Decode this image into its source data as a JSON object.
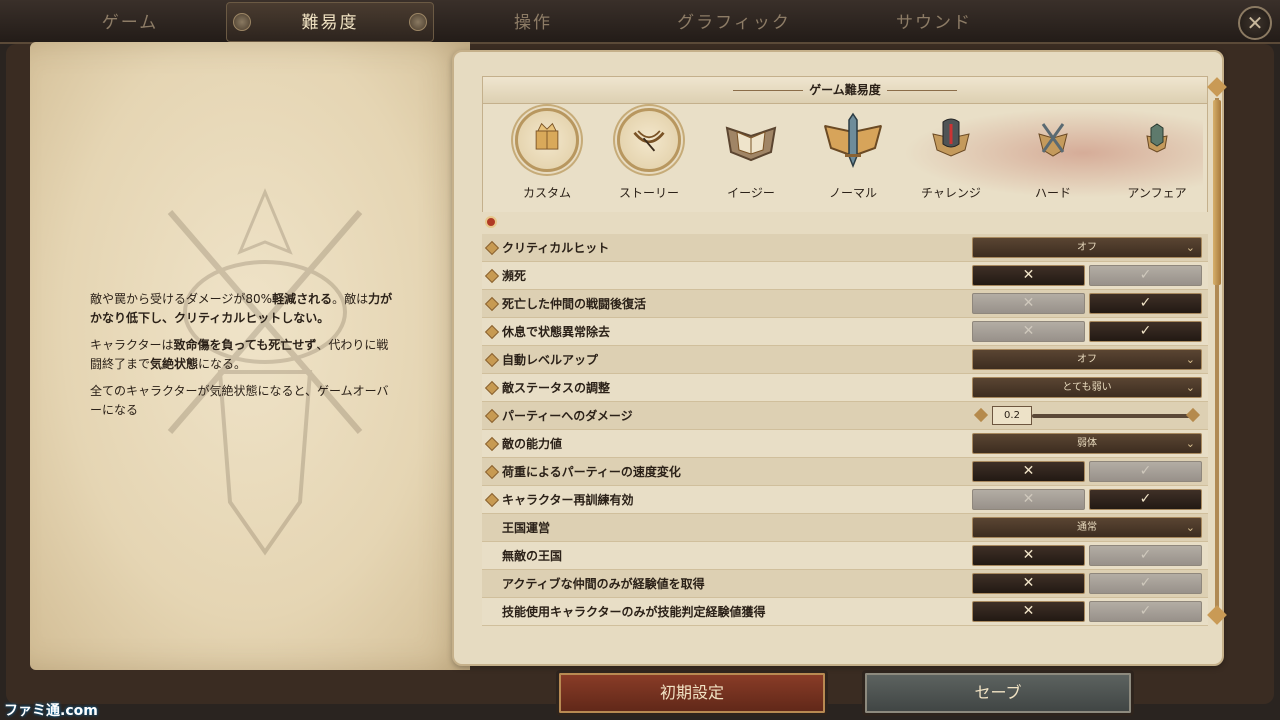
{
  "tabs": [
    {
      "label": "ゲーム"
    },
    {
      "label": "難易度"
    },
    {
      "label": "操作"
    },
    {
      "label": "グラフィック"
    },
    {
      "label": "サウンド"
    }
  ],
  "active_tab": "難易度",
  "close_icon": "✕",
  "description": {
    "p1_a": "敵や罠から受けるダメージが80%",
    "p1_b": "軽減される",
    "p1_c": "。敵は",
    "p1_d": "力がかなり低下し、クリティカルヒットしない。",
    "p2_a": "キャラクターは",
    "p2_b": "致命傷を負っても死亡せず",
    "p2_c": "、代わりに戦闘終了まで",
    "p2_d": "気絶状態",
    "p2_e": "になる。",
    "p3": "全てのキャラクターが気絶状態になると、ゲームオーバーになる"
  },
  "difficulty": {
    "header": "ゲーム難易度",
    "levels": [
      {
        "label": "カスタム",
        "icon": "crown-book-icon"
      },
      {
        "label": "ストーリー",
        "icon": "quill-wings-icon"
      },
      {
        "label": "イージー",
        "icon": "book-wings-icon"
      },
      {
        "label": "ノーマル",
        "icon": "sword-shield-icon"
      },
      {
        "label": "チャレンジ",
        "icon": "helmet-icon"
      },
      {
        "label": "ハード",
        "icon": "crossed-swords-icon"
      },
      {
        "label": "アンフェア",
        "icon": "skull-emblem-icon"
      }
    ],
    "selected": "カスタム"
  },
  "settings": [
    {
      "label": "クリティカルヒット",
      "type": "dropdown",
      "value": "オフ"
    },
    {
      "label": "瀕死",
      "type": "toggle",
      "value": false
    },
    {
      "label": "死亡した仲間の戦闘後復活",
      "type": "toggle",
      "value": true
    },
    {
      "label": "休息で状態異常除去",
      "type": "toggle",
      "value": true
    },
    {
      "label": "自動レベルアップ",
      "type": "dropdown",
      "value": "オフ"
    },
    {
      "label": "敵ステータスの調整",
      "type": "dropdown",
      "value": "とても弱い"
    },
    {
      "label": "パーティーへのダメージ",
      "type": "slider",
      "value": "0.2"
    },
    {
      "label": "敵の能力値",
      "type": "dropdown",
      "value": "弱体"
    },
    {
      "label": "荷重によるパーティーの速度変化",
      "type": "toggle",
      "value": false
    },
    {
      "label": "キャラクター再訓練有効",
      "type": "toggle",
      "value": true
    },
    {
      "label": "王国運営",
      "type": "dropdown",
      "value": "通常"
    },
    {
      "label": "無敵の王国",
      "type": "toggle",
      "value": false
    },
    {
      "label": "アクティブな仲間のみが経験値を取得",
      "type": "toggle",
      "value": false
    },
    {
      "label": "技能使用キャラクターのみが技能判定経験値獲得",
      "type": "toggle",
      "value": false
    }
  ],
  "toggle_glyphs": {
    "no": "✕",
    "yes": "✓"
  },
  "buttons": {
    "reset": "初期設定",
    "save": "セーブ"
  },
  "watermark": "ファミ通.com"
}
